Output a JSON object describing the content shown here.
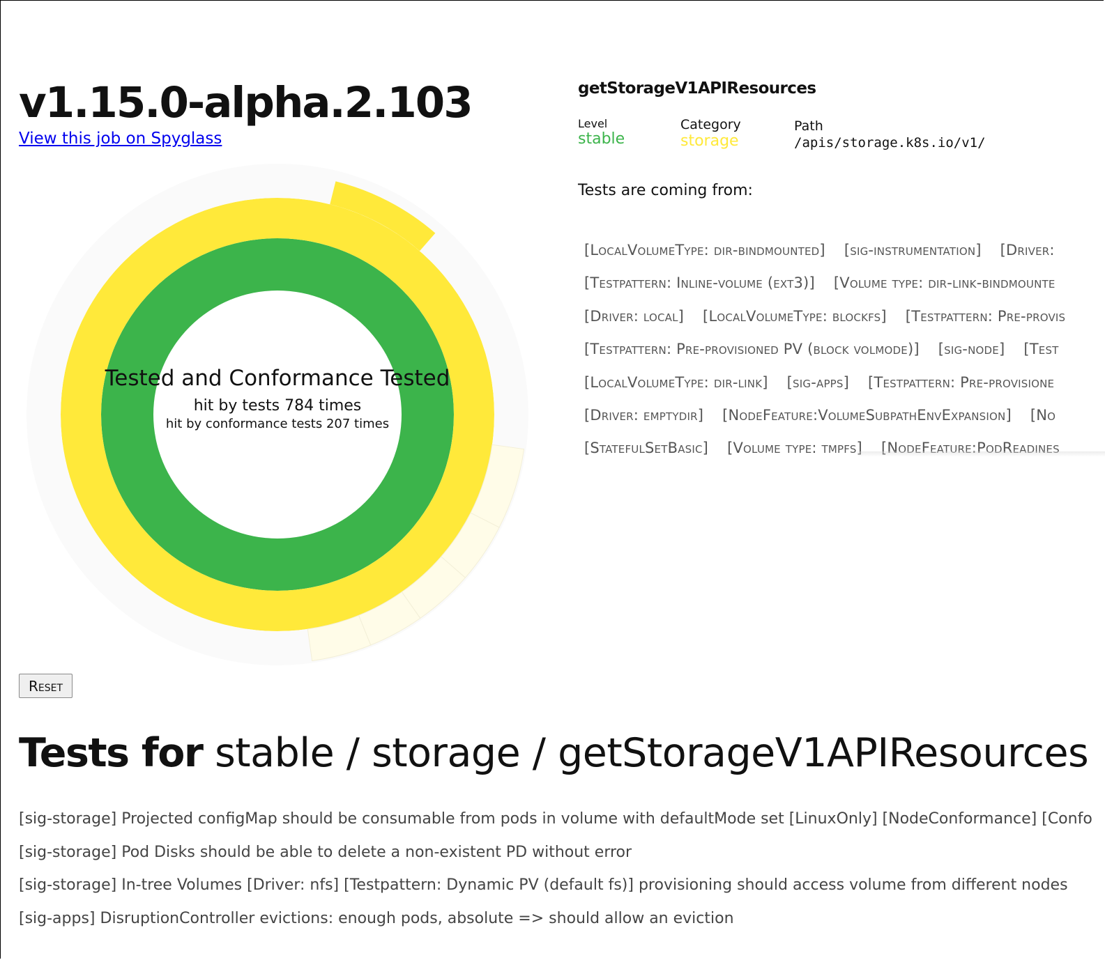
{
  "header": {
    "version": "v1.15.0-alpha.2.103",
    "spyglass_link": "View this job on Spyglass"
  },
  "sunburst": {
    "center_title": "Tested and Conformance Tested",
    "hits_line": "hit by tests 784 times",
    "conformance_line": "hit by conformance tests 207 times",
    "colors": {
      "conformance_tested": "#3cb44b",
      "tested": "#ffe93a",
      "faded_tested": "#fffce8",
      "untested": "#fafafa"
    },
    "arcs": [
      {
        "ring": "inner",
        "start_deg": 0,
        "end_deg": 360,
        "fill": "conformance_tested"
      },
      {
        "ring": "middle",
        "start_deg": 0,
        "end_deg": 360,
        "fill": "tested"
      },
      {
        "ring": "outer",
        "start_deg": 0,
        "end_deg": 360,
        "fill": "untested"
      },
      {
        "ring": "outer-wide",
        "start_deg": 14,
        "end_deg": 41,
        "fill": "tested"
      },
      {
        "ring": "outer-wide",
        "start_deg": 98,
        "end_deg": 117,
        "fill": "faded_tested"
      },
      {
        "ring": "outer-wide",
        "start_deg": 117,
        "end_deg": 131,
        "fill": "faded_tested"
      },
      {
        "ring": "outer-wide",
        "start_deg": 131,
        "end_deg": 145,
        "fill": "faded_tested"
      },
      {
        "ring": "outer-wide",
        "start_deg": 145,
        "end_deg": 158,
        "fill": "faded_tested"
      },
      {
        "ring": "outer-wide",
        "start_deg": 158,
        "end_deg": 172,
        "fill": "faded_tested"
      }
    ]
  },
  "endpoint": {
    "name": "getStorageV1APIResources",
    "level_label": "Level",
    "level_value": "stable",
    "level_color": "#3cb44b",
    "category_label": "Category",
    "category_value": "storage",
    "category_color": "#ffe93a",
    "path_label": "Path",
    "path_value": "/apis/storage.k8s.io/v1/"
  },
  "tests_from": {
    "label": "Tests are coming from:",
    "tag_rows": [
      [
        "[LocalVolumeType: dir-bindmounted]",
        "[sig-instrumentation]",
        "[Driver:"
      ],
      [
        "[Testpattern: Inline-volume (ext3)]",
        "[Volume type: dir-link-bindmounte"
      ],
      [
        "[Driver: local]",
        "[LocalVolumeType: blockfs]",
        "[Testpattern: Pre-provis"
      ],
      [
        "[Testpattern: Pre-provisioned PV (block volmode)]",
        "[sig-node]",
        "[Test"
      ],
      [
        "[LocalVolumeType: dir-link]",
        "[sig-apps]",
        "[Testpattern: Pre-provisione"
      ],
      [
        "[Driver: emptydir]",
        "[NodeFeature:VolumeSubpathEnvExpansion]",
        "[No"
      ],
      [
        "[StatefulSetBasic]",
        "[Volume type: tmpfs]",
        "[NodeFeature:PodReadines"
      ]
    ]
  },
  "reset_button": "Reset",
  "tests_section": {
    "heading_bold": "Tests for",
    "heading_rest": " stable / storage / getStorageV1APIResources",
    "tests": [
      "[sig-storage] Projected configMap should be consumable from pods in volume with defaultMode set [LinuxOnly] [NodeConformance] [Confo",
      "[sig-storage] Pod Disks should be able to delete a non-existent PD without error",
      "[sig-storage] In-tree Volumes [Driver: nfs] [Testpattern: Dynamic PV (default fs)] provisioning should access volume from different nodes",
      "[sig-apps] DisruptionController evictions: enough pods, absolute => should allow an eviction"
    ]
  }
}
